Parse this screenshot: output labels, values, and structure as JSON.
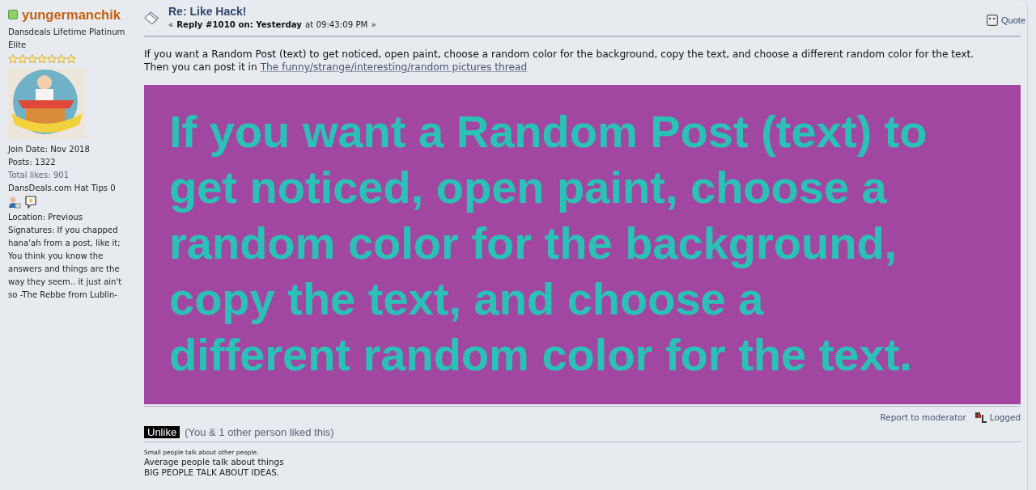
{
  "poster": {
    "name": "yungermanchik",
    "online": true,
    "title": "Dansdeals Lifetime Platinum Elite",
    "stars": 7,
    "stats": [
      {
        "kind": "plain",
        "text": "Join Date: Nov 2018"
      },
      {
        "kind": "plain",
        "text": "Posts: 1322"
      },
      {
        "kind": "muted",
        "text": "Total likes: 901"
      },
      {
        "kind": "plain",
        "text": "DansDeals.com Hat Tips 0"
      }
    ],
    "location": "Location: Previous",
    "signature_note": "Signatures: If you chapped hana'ah from a post, like it; You think you know the answers and things are the way they seem.. it just ain't so -The Rebbe from Lublin-"
  },
  "post": {
    "subject": "Re: Like Hack!",
    "reply_prefix": "«",
    "reply_label": "Reply #1010 on: Yesterday",
    "reply_time": "at 09:43:09 PM",
    "reply_suffix": "»",
    "quote_label": "Quote",
    "body": "If you want a Random Post (text) to get noticed, open paint, choose a random color for the background, copy the text, and choose a different random color for the text.",
    "body2": "Then you can post it in",
    "link": "The funny/strange/interesting/random pictures thread",
    "image_lines": [
      "If you want a Random Post (text) to",
      "get noticed, open paint, choose a",
      "random color for the background,",
      "copy the text, and choose a",
      "different random color for the text."
    ],
    "report_label": "Report to moderator",
    "logged_label": "Logged",
    "like_button": "Unlike",
    "like_note": "(You & 1 other person liked this)",
    "signature": [
      {
        "kind": "small",
        "text": "Small people talk about other people."
      },
      {
        "kind": "normal",
        "text": "Average people talk about things"
      },
      {
        "kind": "normal",
        "text": "BIG PEOPLE TALK ABOUT IDEAS."
      }
    ]
  }
}
